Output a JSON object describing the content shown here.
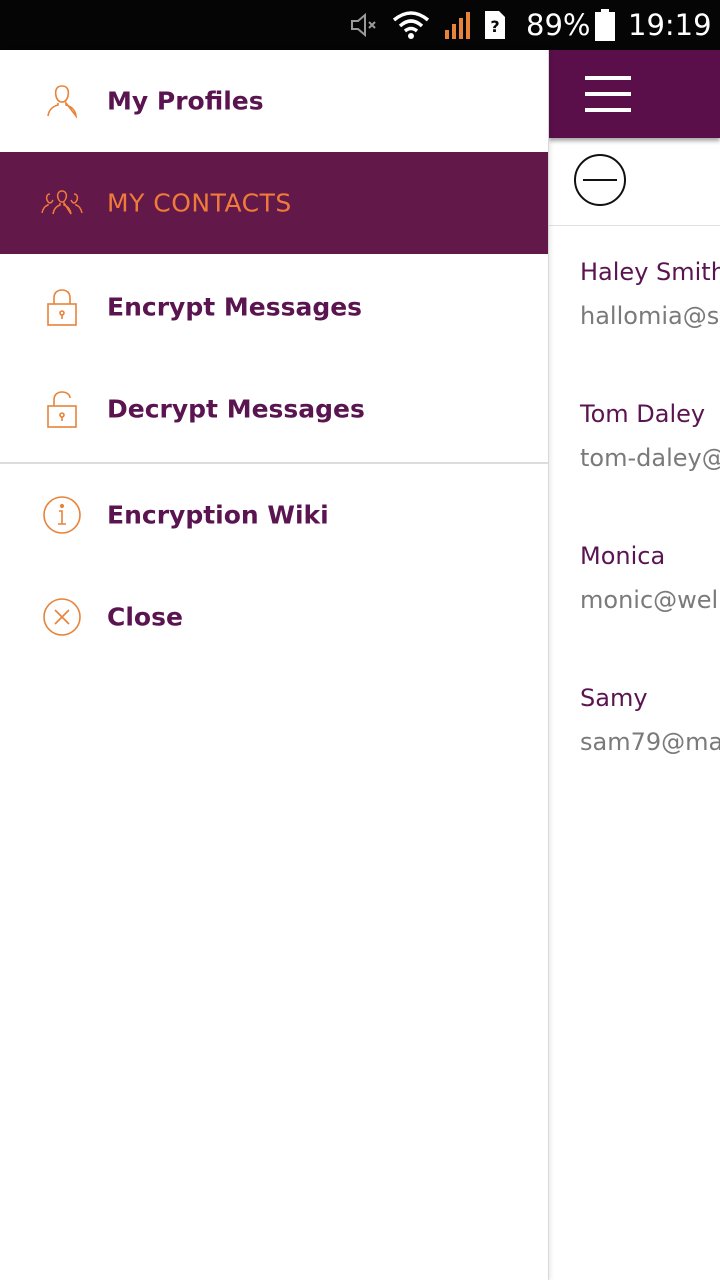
{
  "status_bar": {
    "battery_percent": "89%",
    "time": "19:19",
    "icons": [
      "mute-icon",
      "wifi-icon",
      "signal-icon",
      "sim-unknown-icon",
      "battery-icon"
    ]
  },
  "colors": {
    "brand_purple": "#621848",
    "accent_orange": "#f07a3a",
    "text_purple": "#5a1450"
  },
  "drawer": {
    "items": [
      {
        "label": "My Profiles",
        "icon": "user-icon",
        "active": false
      },
      {
        "label": "MY CONTACTS",
        "icon": "contacts-icon",
        "active": true
      },
      {
        "label": "Encrypt Messages",
        "icon": "lock-icon",
        "active": false
      },
      {
        "label": "Decrypt Messages",
        "icon": "unlock-icon",
        "active": false
      },
      {
        "label": "Encryption Wiki",
        "icon": "info-icon",
        "active": false
      },
      {
        "label": "Close",
        "icon": "close-icon",
        "active": false
      }
    ]
  },
  "content": {
    "contacts": [
      {
        "name": "Haley Smith",
        "email": "hallomia@s"
      },
      {
        "name": "Tom Daley",
        "email": "tom-daley@"
      },
      {
        "name": "Monica",
        "email": "monic@wel"
      },
      {
        "name": "Samy",
        "email": "sam79@ma"
      }
    ]
  }
}
